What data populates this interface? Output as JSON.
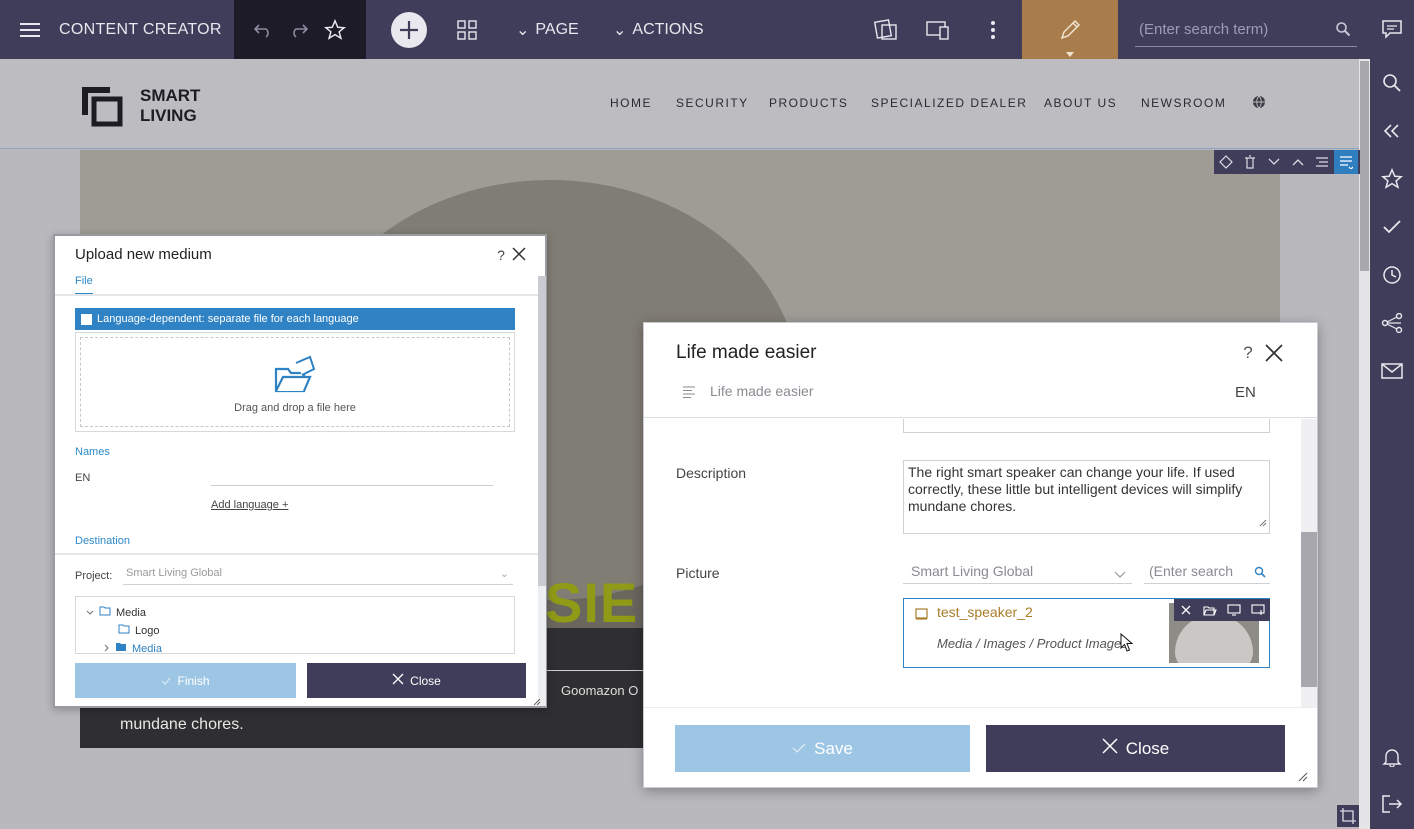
{
  "topbar": {
    "title": "CONTENT CREATOR",
    "menu_page": "PAGE",
    "menu_actions": "ACTIONS",
    "search_placeholder": "(Enter search term)"
  },
  "site": {
    "logo_line1": "SMART",
    "logo_line2": "LIVING",
    "nav": [
      "HOME",
      "SECURITY",
      "PRODUCTS",
      "SPECIALIZED DEALER",
      "ABOUT US",
      "NEWSROOM"
    ],
    "hero_word": "SIE",
    "hero_text": "mundane chores.",
    "hero_button": "Goomazon O"
  },
  "upload_dialog": {
    "title": "Upload new medium",
    "tab_file": "File",
    "language_dependent": "Language-dependent: separate file for each language",
    "dropzone_text": "Drag and drop a file here",
    "names_label": "Names",
    "lang_code": "EN",
    "add_language": "Add language +",
    "tab_destination": "Destination",
    "project_label": "Project:",
    "project_value": "Smart Living Global",
    "tree": {
      "root": "Media",
      "child1": "Logo",
      "child2": "Media"
    },
    "finish_label": "Finish",
    "close_label": "Close"
  },
  "edit_dialog": {
    "title": "Life made easier",
    "subtitle": "Life made easier",
    "language": "EN",
    "description_label": "Description",
    "description_value": "The right smart speaker can change your life. If used correctly, these little but intelligent devices will simplify mundane chores.",
    "picture_label": "Picture",
    "picture_project": "Smart Living Global",
    "picture_search_placeholder": "(Enter search",
    "picture_name": "test_speaker_2",
    "picture_path": "Media / Images / Product Images",
    "save_label": "Save",
    "close_label": "Close"
  },
  "colors": {
    "chrome": "#3f3d5a",
    "accent_blue": "#2f82c4",
    "edit_mode": "#a97c4b",
    "disabled_blue": "#9cc6e4",
    "hero_word": "#8f9b16"
  }
}
